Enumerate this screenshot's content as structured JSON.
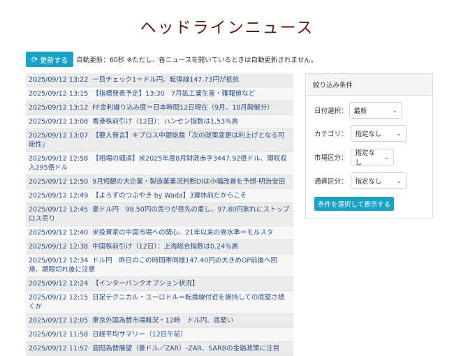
{
  "page_title": "ヘッドラインニュース",
  "refresh": {
    "button_label": "更新する",
    "note": "自動更新：60秒 ※ただし、各ニュースを開いているときは自動更新されません。"
  },
  "news": [
    {
      "time": "2025/09/12 13:22",
      "headline": "一目チェック1＝ドル円、転換線147.73円が抵抗"
    },
    {
      "time": "2025/09/12 13:15",
      "headline": "【指標発表予定】13:30　7月鉱工業生産・確報値など"
    },
    {
      "time": "2025/09/12 13:12",
      "headline": "FF金利織り込み度＝日本時間12日現在（9月、10月開催分）"
    },
    {
      "time": "2025/09/12 13:08",
      "headline": "香港株前引け（12日）：ハンセン指数は1.53％高"
    },
    {
      "time": "2025/09/12 13:07",
      "headline": "【要人発言】キプロス中銀総裁「次の政策変更は利上げとなる可能性」"
    },
    {
      "time": "2025/09/12 12:58",
      "headline": "【相場の細道】米2025年度8月財政赤字3447.92億ドル、関税収入295億ドル"
    },
    {
      "time": "2025/09/12 12:50",
      "headline": "9月短観の大企業・製造業業況判断DIは小幅改善を予想-明治安田"
    },
    {
      "time": "2025/09/12 12:49",
      "headline": "【よろずのつぶやき by Wada】3連休前だからこそ"
    },
    {
      "time": "2025/09/12 12:45",
      "headline": "豪ドル円　98.50円の売りが目先の重し、97.80円割れにストップロス売り"
    },
    {
      "time": "2025/09/12 12:40",
      "headline": "米投資家の中国市場への関心、21年以来の高水準＝モルスタ"
    },
    {
      "time": "2025/09/12 12:38",
      "headline": "中国株前引け（12日）：上海総合指数は0.24％高"
    },
    {
      "time": "2025/09/12 12:34",
      "headline": "ドル円　昨日のこの時間帯同様147.40円の大きめOP前後へ回帰、期限切れ後に注意"
    },
    {
      "time": "2025/09/12 12:24",
      "headline": "【インターバンクオプション状況】"
    },
    {
      "time": "2025/09/12 12:15",
      "headline": "日足テクニカル・ユーロドル＝転換線付近を維持しての底堅さ続くか"
    },
    {
      "time": "2025/09/12 12:05",
      "headline": "東京外国為替市場概況・12時　ドル円、底堅い"
    },
    {
      "time": "2025/09/12 11:58",
      "headline": "日経平均サマリー（12日午前）"
    },
    {
      "time": "2025/09/12 11:52",
      "headline": "週間為替展望（豪ドル／ZAR）-ZAR、SARBの金融政策に注目"
    }
  ],
  "filter": {
    "title": "絞り込み条件",
    "date": {
      "label": "日付選択：",
      "value": "最新"
    },
    "category": {
      "label": "カテゴリ：",
      "value": "指定なし"
    },
    "market": {
      "label": "市場区分：",
      "value": "指定なし"
    },
    "currency": {
      "label": "通貨区分：",
      "value": "指定なし"
    },
    "apply_label": "条件を選択して表示する"
  },
  "colors": {
    "accent": "#1aa2c5",
    "title": "#5a1e14",
    "link": "#2a4e8a"
  }
}
